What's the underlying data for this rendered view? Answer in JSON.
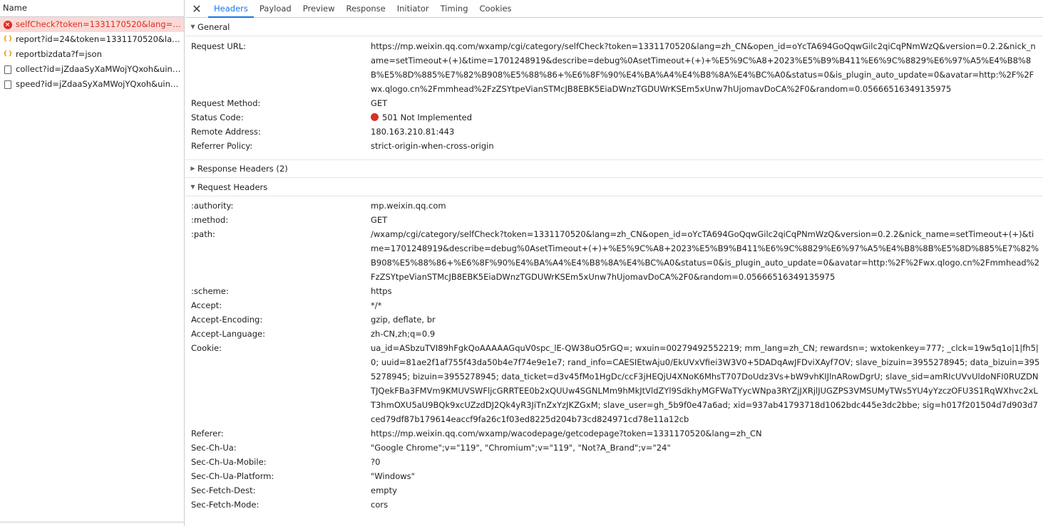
{
  "list": {
    "header": "Name",
    "items": [
      {
        "name": "selfCheck?token=1331170520&lang=zh_C...",
        "icon": "error-icon",
        "selected": true
      },
      {
        "name": "report?id=24&token=1331170520&lang=...",
        "icon": "json-icon"
      },
      {
        "name": "reportbizdata?f=json",
        "icon": "json-icon"
      },
      {
        "name": "collect?id=jZdaaSyXaMWojYQxoh&uin=o...",
        "icon": "document-icon"
      },
      {
        "name": "speed?id=jZdaaSyXaMWojYQxoh&uin=oY...",
        "icon": "document-icon"
      }
    ]
  },
  "tabs": {
    "close": "✕",
    "items": [
      "Headers",
      "Payload",
      "Preview",
      "Response",
      "Initiator",
      "Timing",
      "Cookies"
    ],
    "active": "Headers"
  },
  "general": {
    "title": "General",
    "rows": [
      {
        "k": "Request URL:",
        "v": "https://mp.weixin.qq.com/wxamp/cgi/category/selfCheck?token=1331170520&lang=zh_CN&open_id=oYcTA694GoQqwGilc2qiCqPNmWzQ&version=0.2.2&nick_name=setTimeout+(+)&time=1701248919&describe=debug%0AsetTimeout+(+)+%E5%9C%A8+2023%E5%B9%B411%E6%9C%8829%E6%97%A5%E4%B8%8B%E5%8D%885%E7%82%B908%E5%88%86+%E6%8F%90%E4%BA%A4%E4%B8%8A%E4%BC%A0&status=0&is_plugin_auto_update=0&avatar=http:%2F%2Fwx.qlogo.cn%2Fmmhead%2FzZSYtpeVianSTMcJB8EBK5EiaDWnzTGDUWrKSEm5xUnw7hUjomavDoCA%2F0&random=0.05666516349135975"
      },
      {
        "k": "Request Method:",
        "v": "GET"
      },
      {
        "k": "Status Code:",
        "v": "501 Not Implemented",
        "status": true
      },
      {
        "k": "Remote Address:",
        "v": "180.163.210.81:443"
      },
      {
        "k": "Referrer Policy:",
        "v": "strict-origin-when-cross-origin"
      }
    ]
  },
  "response_headers": {
    "title": "Response Headers (2)"
  },
  "request_headers": {
    "title": "Request Headers",
    "rows": [
      {
        "k": ":authority:",
        "v": "mp.weixin.qq.com"
      },
      {
        "k": ":method:",
        "v": "GET"
      },
      {
        "k": ":path:",
        "v": "/wxamp/cgi/category/selfCheck?token=1331170520&lang=zh_CN&open_id=oYcTA694GoQqwGilc2qiCqPNmWzQ&version=0.2.2&nick_name=setTimeout+(+)&time=1701248919&describe=debug%0AsetTimeout+(+)+%E5%9C%A8+2023%E5%B9%B411%E6%9C%8829%E6%97%A5%E4%B8%8B%E5%8D%885%E7%82%B908%E5%88%86+%E6%8F%90%E4%BA%A4%E4%B8%8A%E4%BC%A0&status=0&is_plugin_auto_update=0&avatar=http:%2F%2Fwx.qlogo.cn%2Fmmhead%2FzZSYtpeVianSTMcJB8EBK5EiaDWnzTGDUWrKSEm5xUnw7hUjomavDoCA%2F0&random=0.05666516349135975"
      },
      {
        "k": ":scheme:",
        "v": "https"
      },
      {
        "k": "Accept:",
        "v": "*/*"
      },
      {
        "k": "Accept-Encoding:",
        "v": "gzip, deflate, br"
      },
      {
        "k": "Accept-Language:",
        "v": "zh-CN,zh;q=0.9"
      },
      {
        "k": "Cookie:",
        "v": "ua_id=ASbzuTVI89hFgkQoAAAAAGquV0spc_lE-QW38uO5rGQ=; wxuin=00279492552219; mm_lang=zh_CN; rewardsn=; wxtokenkey=777; _clck=19w5q1o|1|fh5|0; uuid=81ae2f1af755f43da50b4e7f74e9e1e7; rand_info=CAESIEtwAju0/EkUVxVfiei3W3V0+5DADqAwJFDviXAyf7OV; slave_bizuin=3955278945; data_bizuin=3955278945; bizuin=3955278945; data_ticket=d3v45fMo1HgDc/ccF3jHEQjU4XNoK6MhsT707DoUdz3Vs+bW9vhKIJlnARowDgrU; slave_sid=amRIcUVvUldoNFI0RUZDNTJQekFBa3FMVm9KMUVSWFljcGRRTEE0b2xQUUw4SGNLMm9hMkJtVldZYl9SdkhyMGFWaTYycWNpa3RYZjJXRjlJUGZPS3VMSUMyTWs5YU4yYzczOFU3S1RqWXhvc2xLT3hmOXU5aU9BQk9xcUZzdDJ2Qk4yR3JiTnZxYzJKZGxM; slave_user=gh_5b9f0e47a6ad; xid=937ab41793718d1062bdc445e3dc2bbe; sig=h017f201504d7d903d7ced79df87b179614eaccf9fa26c1f03ed8225d204b73cd824971cd78e11a12cb"
      },
      {
        "k": "Referer:",
        "v": "https://mp.weixin.qq.com/wxamp/wacodepage/getcodepage?token=1331170520&lang=zh_CN"
      },
      {
        "k": "Sec-Ch-Ua:",
        "v": "\"Google Chrome\";v=\"119\", \"Chromium\";v=\"119\", \"Not?A_Brand\";v=\"24\""
      },
      {
        "k": "Sec-Ch-Ua-Mobile:",
        "v": "?0"
      },
      {
        "k": "Sec-Ch-Ua-Platform:",
        "v": "\"Windows\""
      },
      {
        "k": "Sec-Fetch-Dest:",
        "v": "empty"
      },
      {
        "k": "Sec-Fetch-Mode:",
        "v": "cors"
      }
    ]
  },
  "colors": {
    "accent": "#1a73e8",
    "error": "#d93025",
    "selected_row": "#fbd9d6"
  }
}
